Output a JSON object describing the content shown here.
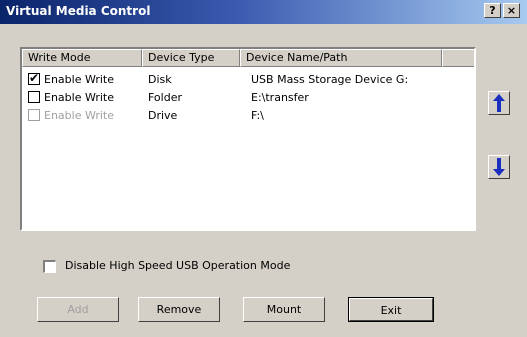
{
  "window": {
    "title": "Virtual Media Control",
    "help_label": "?",
    "close_label": "×"
  },
  "list": {
    "columns": [
      "Write Mode",
      "Device Type",
      "Device Name/Path",
      ""
    ],
    "rows": [
      {
        "checked": true,
        "enabled": true,
        "write_mode": "Enable Write",
        "device_type": "Disk",
        "device_path": "USB Mass Storage Device G:"
      },
      {
        "checked": false,
        "enabled": true,
        "write_mode": "Enable Write",
        "device_type": "Folder",
        "device_path": "E:\\transfer"
      },
      {
        "checked": false,
        "enabled": false,
        "write_mode": "Enable Write",
        "device_type": "Drive",
        "device_path": "F:\\"
      }
    ]
  },
  "controls": {
    "move_up_icon": "arrow-up",
    "move_down_icon": "arrow-down",
    "arrow_color": "#1a2fbf"
  },
  "options": {
    "disable_high_speed_usb": {
      "label": "Disable High Speed USB Operation Mode",
      "checked": false
    }
  },
  "buttons": {
    "add": "Add",
    "remove": "Remove",
    "mount": "Mount",
    "exit": "Exit"
  }
}
